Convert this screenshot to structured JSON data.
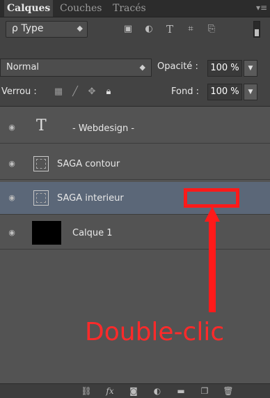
{
  "tabs": [
    {
      "label": "Calques",
      "active": true
    },
    {
      "label": "Couches",
      "active": false
    },
    {
      "label": "Tracés",
      "active": false
    }
  ],
  "filter": {
    "kind_label": "ρ Type",
    "icons": [
      "image-filter-icon",
      "adjustment-filter-icon",
      "text-filter-icon",
      "shape-filter-icon",
      "smart-object-filter-icon"
    ]
  },
  "blend": {
    "mode": "Normal",
    "opacity_label": "Opacité :",
    "opacity_value": "100 %"
  },
  "lock": {
    "label": "Verrou :",
    "icons": [
      "lock-transparency-icon",
      "lock-pixels-icon",
      "lock-position-icon",
      "lock-all-icon"
    ],
    "fill_label": "Fond :",
    "fill_value": "100 %"
  },
  "layers": [
    {
      "name": "- Webdesign -",
      "type": "group-text",
      "selected": false
    },
    {
      "name": "SAGA contour",
      "type": "path",
      "selected": false
    },
    {
      "name": "SAGA interieur",
      "type": "path",
      "selected": true
    },
    {
      "name": "Calque 1",
      "type": "pixel",
      "selected": false
    }
  ],
  "annotation": {
    "text": "Double-clic",
    "color": "#ff1a1a"
  },
  "bottom_icons": [
    "link-icon",
    "fx-icon",
    "mask-icon",
    "adjustment-icon",
    "folder-icon",
    "new-layer-icon",
    "trash-icon"
  ],
  "colors": {
    "panel": "#434343",
    "selected_row": "#5b6778",
    "accent_red": "#ff1a1a"
  }
}
